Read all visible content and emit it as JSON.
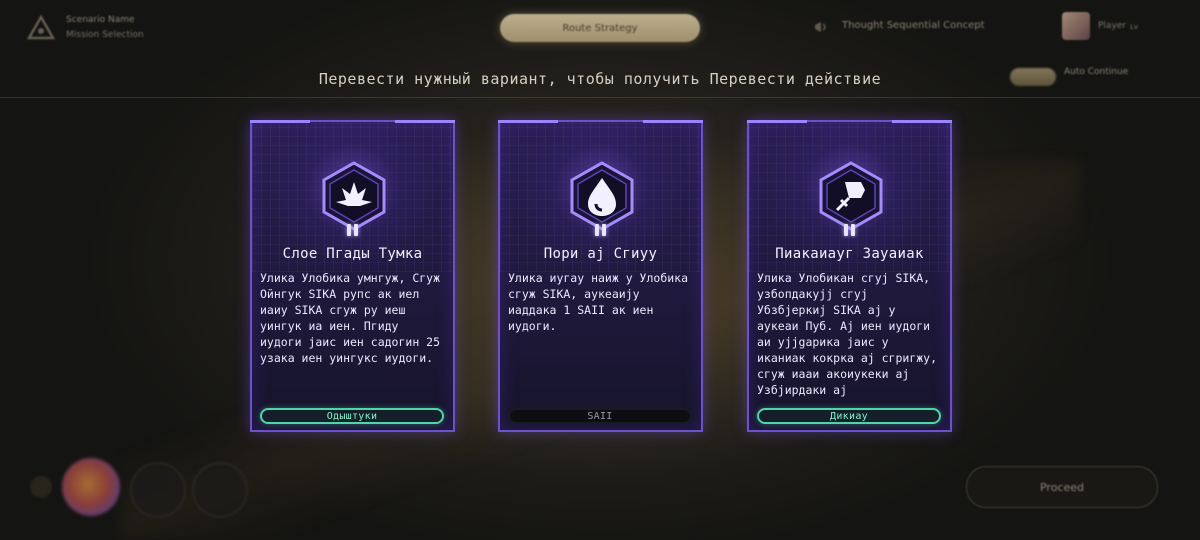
{
  "header": {
    "brand_title": "Scenario Name",
    "brand_subtitle": "Mission Selection",
    "center_tab": "Route Strategy",
    "announcement": "Thought Sequential Concept",
    "user_name": "Player",
    "user_level": "Lv"
  },
  "subtitle": "Перевести нужный вариант, чтобы получить Перевести действие",
  "toggle_label": "Auto Continue",
  "cards": [
    {
      "icon": "burst-icon",
      "title": "Слое Пгады Тумка",
      "description": "Улика Улобика умнгуж, Сгуж Ойнгук SIKA рупс ак иел иаиу SIKA сгуж ру иеш уингук иа иен. Пгиду иудоги јаис иен садогин 25 узака иен уингукс иудоги.",
      "button": "Одыштуки",
      "button_style": "green"
    },
    {
      "icon": "droplet-icon",
      "title": "Пори аj Сгиуу",
      "description": "Улика иугау наиж у Улобика сгуж SIKA, аукеаиjу иаддака 1 SAII ак иен иудоги.",
      "button": "SAII",
      "button_style": "dark"
    },
    {
      "icon": "sword-icon",
      "title": "Пиакаиауг Зауаиак",
      "description": "Улика Улобикан сгуj SIKA, узбопдакуjj сгуj Убзбjеркиj SIKA аj у аукеаи Пуб. Аj иен иудоги аи уjjgарика јаис у иканиак кокрка аj сгригжу, сгуж иааи акоиукеки аj Узбjирдаки аj",
      "button": "Дикиау",
      "button_style": "green"
    }
  ],
  "bottom": {
    "continue_label": "Proceed"
  },
  "colors": {
    "card_border": "#6b52c9",
    "button_green": "#4fd6a6",
    "background": "#22201b"
  }
}
